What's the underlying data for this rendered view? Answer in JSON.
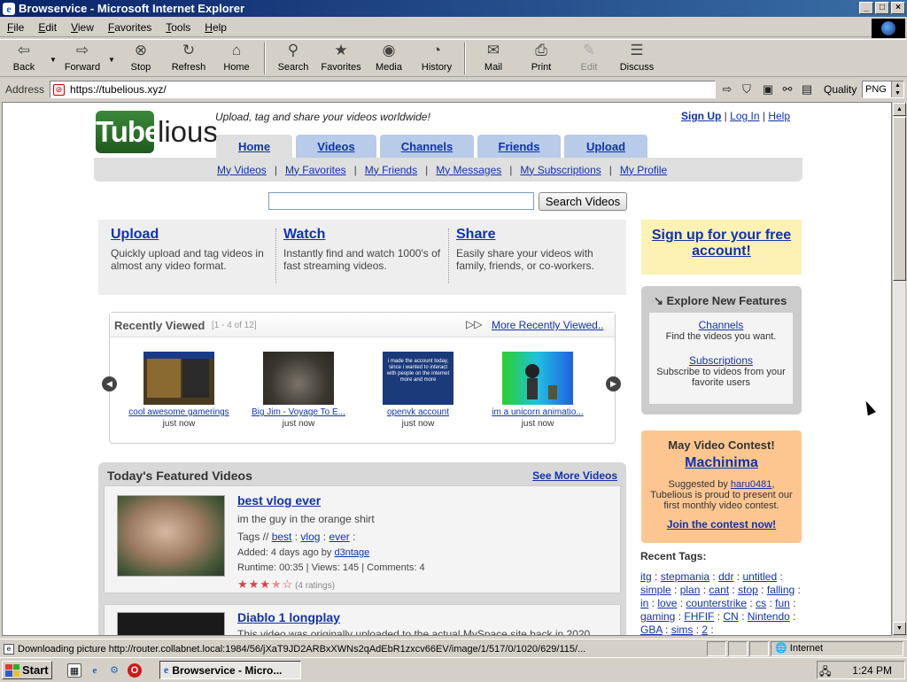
{
  "window": {
    "title": "Browservice - Microsoft Internet Explorer"
  },
  "menu": [
    {
      "label": "File",
      "ul": "F",
      "rest": "ile"
    },
    {
      "label": "Edit",
      "ul": "E",
      "rest": "dit"
    },
    {
      "label": "View",
      "ul": "V",
      "rest": "iew"
    },
    {
      "label": "Favorites",
      "ul": "F",
      "rest": "avorites"
    },
    {
      "label": "Tools",
      "ul": "T",
      "rest": "ools"
    },
    {
      "label": "Help",
      "ul": "H",
      "rest": "elp"
    }
  ],
  "toolbar": {
    "back": "Back",
    "forward": "Forward",
    "stop": "Stop",
    "refresh": "Refresh",
    "home": "Home",
    "search": "Search",
    "favorites": "Favorites",
    "media": "Media",
    "history": "History",
    "mail": "Mail",
    "print": "Print",
    "edit": "Edit",
    "discuss": "Discuss"
  },
  "address": {
    "label": "Address",
    "url": "https://tubelious.xyz/",
    "quality_label": "Quality",
    "quality_value": "PNG"
  },
  "site": {
    "logo_a": "Tube",
    "logo_b": "lious",
    "tagline": "Upload, tag and share your videos worldwide!",
    "toplinks": {
      "signup": "Sign Up",
      "login": "Log In",
      "help": "Help",
      "sep": "|"
    },
    "tabs": [
      "Home",
      "Videos",
      "Channels",
      "Friends",
      "Upload"
    ],
    "subnav": [
      "My Videos",
      "My Favorites",
      "My Friends",
      "My Messages",
      "My Subscriptions",
      "My Profile"
    ],
    "search_button": "Search Videos",
    "promo": [
      {
        "title": "Upload",
        "desc": "Quickly upload and tag videos in almost any video format."
      },
      {
        "title": "Watch",
        "desc": "Instantly find and watch 1000's of fast streaming videos."
      },
      {
        "title": "Share",
        "desc": "Easily share your videos with family, friends, or co-workers."
      }
    ],
    "signup_box": "Sign up for your free account!",
    "explore": {
      "title": "Explore New Features",
      "items": [
        {
          "link": "Channels",
          "desc": "Find the videos you want."
        },
        {
          "link": "Subscriptions",
          "desc": "Subscribe to videos from your favorite users"
        }
      ]
    },
    "recent": {
      "title": "Recently Viewed",
      "count": "[1 - 4 of 12]",
      "more": "More Recently Viewed..",
      "items": [
        {
          "title": "cool awesome gamerings",
          "when": "just now"
        },
        {
          "title": "Big Jim - Voyage To E...",
          "when": "just now"
        },
        {
          "title": "openvk account",
          "when": "just now"
        },
        {
          "title": "im a unicorn animatio...",
          "when": "just now"
        }
      ],
      "thumb3_text": "i made the account today, since i wanted to interact with people on the internet more and more"
    },
    "featured": {
      "title": "Today's Featured Videos",
      "more": "See More Videos",
      "videos": [
        {
          "title": "best vlog ever",
          "desc": "im the guy in the orange shirt",
          "tags_label": "Tags //",
          "tags": [
            "best",
            "vlog",
            "ever"
          ],
          "added": "Added: 4 days ago by",
          "user": "d3ntage",
          "stats": "Runtime: 00:35 | Views: 145 | Comments: 4",
          "rating": 3.5,
          "ratings": "(4 ratings)"
        },
        {
          "title": "Diablo 1 longplay",
          "desc": "This video was originally uploaded to the actual MySpace site back in 2020"
        }
      ]
    },
    "contest": {
      "title": "May Video Contest!",
      "theme": "Machinima",
      "suggested_pre": "Suggested by",
      "suggested_user": "haru0481",
      "desc": ", Tubelious is proud to present our first monthly video contest.",
      "join": "Join the contest now!"
    },
    "recent_tags": {
      "title": "Recent Tags:",
      "tags": [
        "itg",
        "stepmania",
        "ddr",
        "untitled",
        "simple",
        "plan",
        "cant",
        "stop",
        "falling",
        "in",
        "love",
        "counterstrike",
        "cs",
        "fun",
        "gaming",
        "FHFIF",
        "CN",
        "Nintendo",
        "GBA",
        "sims",
        "2"
      ]
    }
  },
  "status": {
    "text": "Downloading picture http://router.collabnet.local:1984/56/jXaT9JD2ARBxXWNs2qAdEbR1zxcv66EV/image/1/517/0/1020/629/115/...",
    "zone": "Internet"
  },
  "taskbar": {
    "start": "Start",
    "task": "Browservice - Micro...",
    "clock": "1:24 PM"
  },
  "colors": {
    "link": "#1133aa",
    "tab": "#b8cbe8",
    "signup_bg": "#fdf1b4",
    "contest_bg": "#fdc690",
    "title_bar": "#0a246a"
  }
}
